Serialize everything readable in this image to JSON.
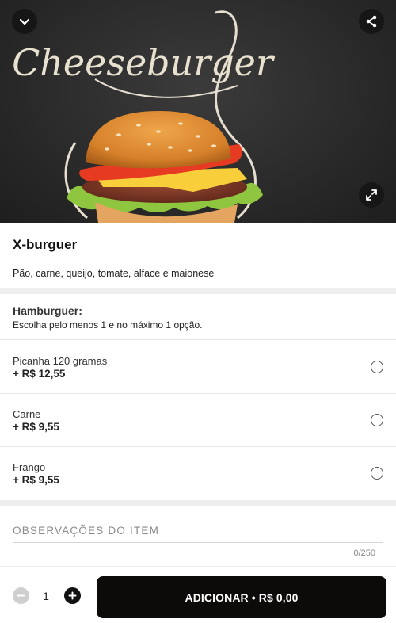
{
  "hero": {
    "logo_text": "Cheeseburger",
    "icons": {
      "collapse": "chevron-down-icon",
      "share": "share-icon",
      "expand": "expand-icon"
    }
  },
  "product": {
    "name": "X-burguer",
    "description": "Pão, carne, queijo, tomate, alface e maionese"
  },
  "group": {
    "title": "Hamburguer:",
    "rule": "Escolha pelo menos 1 e no máximo 1 opção.",
    "options": [
      {
        "name": "Picanha 120 gramas",
        "price": "+ R$ 12,55",
        "selected": false
      },
      {
        "name": "Carne",
        "price": "+ R$ 9,55",
        "selected": false
      },
      {
        "name": "Frango",
        "price": "+ R$ 9,55",
        "selected": false
      }
    ]
  },
  "notes": {
    "label": "OBSERVAÇÕES DO ITEM",
    "counter": "0/250"
  },
  "footer": {
    "quantity": "1",
    "add_label": "ADICIONAR • R$ 0,00"
  },
  "colors": {
    "primary_button": "#0d0a0a",
    "divider": "#eeeeee",
    "plus_button": "#111111",
    "minus_button": "#cfcfcf"
  }
}
